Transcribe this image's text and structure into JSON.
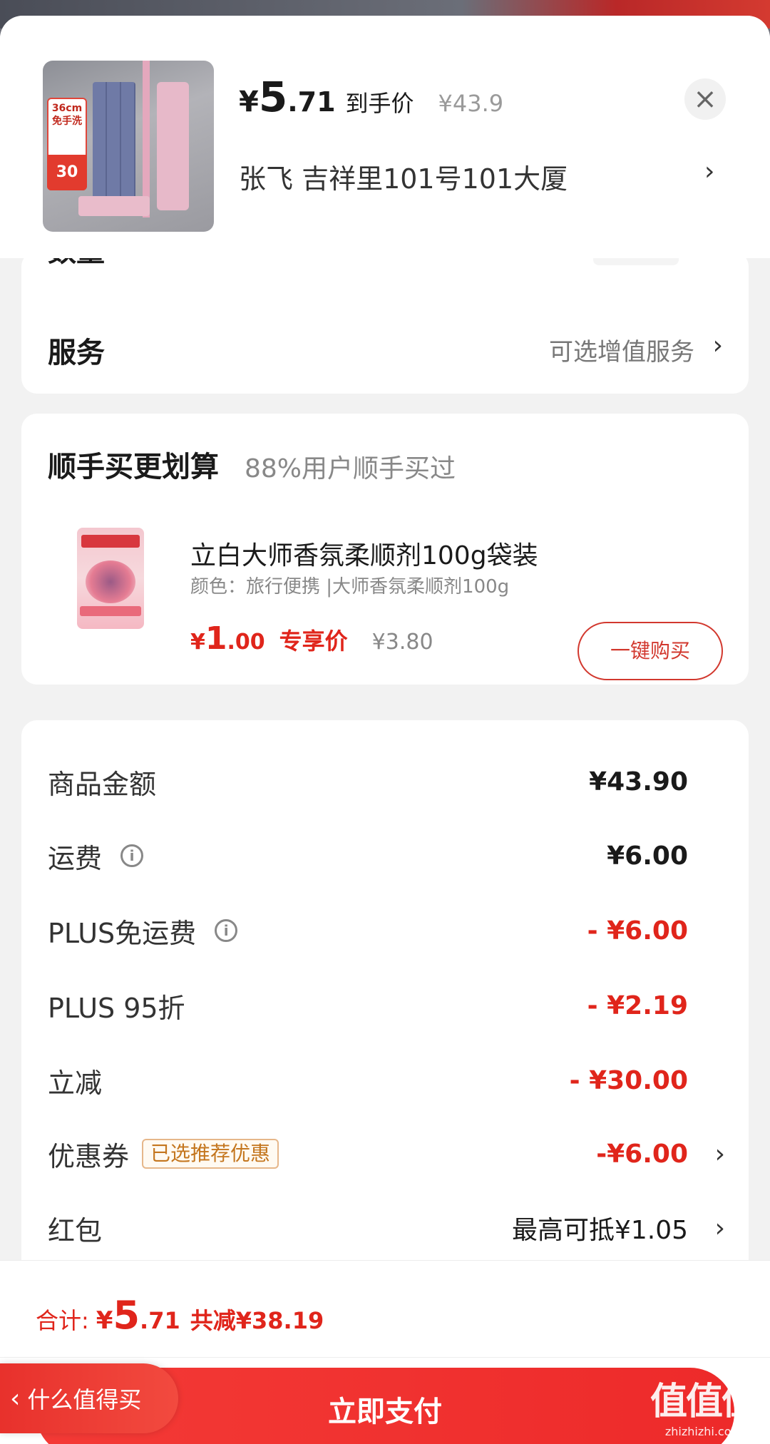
{
  "header": {
    "price_yen": "¥",
    "price_int": "5",
    "price_dec": ".71",
    "price_tag": "到手价",
    "price_original": "¥43.9",
    "close_glyph": "×",
    "address": "张飞  吉祥里101号101大厦",
    "chevron": "›",
    "thumb_tag_top": "36cm",
    "thumb_tag_sub": "免手洗",
    "thumb_tag_bottom": "30"
  },
  "service_card": {
    "quantity_label": "数量",
    "service_label": "服务",
    "service_value": "可选增值服务",
    "chevron": "›"
  },
  "combo": {
    "title": "顺手买更划算",
    "subtitle": "88%用户顺手买过",
    "product_name": "立白大师香氛柔顺剂100g袋装",
    "product_spec": "颜色：旅行便携 |大师香氛柔顺剂100g",
    "price_yen": "¥",
    "price_int": "1",
    "price_dec": ".00",
    "price_tag": "专享价",
    "price_original": "¥3.80",
    "buy_button": "一键购买"
  },
  "summary": {
    "rows": [
      {
        "label": "商品金额",
        "value": "¥43.90"
      },
      {
        "label": "运费",
        "value": "¥6.00",
        "info": "i"
      },
      {
        "label": "PLUS免运费",
        "value": "- ¥6.00",
        "info": "i"
      },
      {
        "label": "PLUS 95折",
        "value": "- ¥2.19"
      },
      {
        "label": "立减",
        "value": "- ¥30.00"
      },
      {
        "label": "优惠券",
        "badge": "已选推荐优惠",
        "value": "-¥6.00",
        "chevron": "›"
      },
      {
        "label": "红包",
        "value": "最高可抵¥1.05",
        "chevron": "›"
      }
    ]
  },
  "bottom": {
    "total_label": "合计:",
    "total_yen": "¥",
    "total_int": "5",
    "total_dec": ".71",
    "total_saved": "共减¥38.19",
    "pay_button": "立即支付",
    "back_label": "什么值得买",
    "back_arrow": "‹",
    "watermark_big": "值值值",
    "watermark_small": "zhizhizhi.com"
  },
  "colors": {
    "accent_red": "#e0251b",
    "pay_button": "#ef2e2c",
    "badge_border": "#e6b78a"
  }
}
